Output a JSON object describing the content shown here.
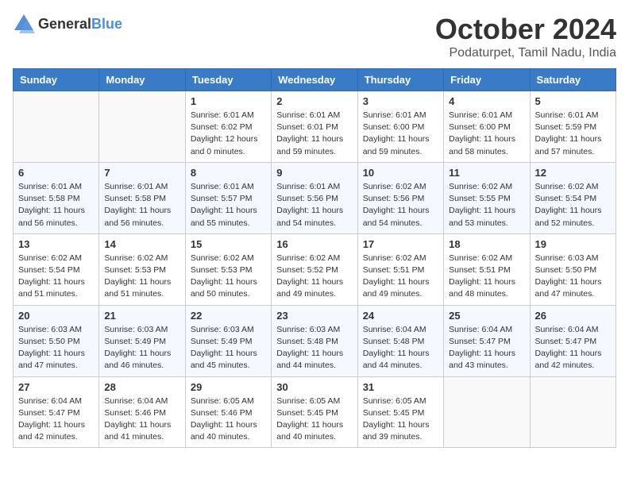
{
  "header": {
    "logo_general": "General",
    "logo_blue": "Blue",
    "month": "October 2024",
    "location": "Podaturpet, Tamil Nadu, India"
  },
  "weekdays": [
    "Sunday",
    "Monday",
    "Tuesday",
    "Wednesday",
    "Thursday",
    "Friday",
    "Saturday"
  ],
  "weeks": [
    [
      {
        "day": "",
        "info": ""
      },
      {
        "day": "",
        "info": ""
      },
      {
        "day": "1",
        "info": "Sunrise: 6:01 AM\nSunset: 6:02 PM\nDaylight: 12 hours\nand 0 minutes."
      },
      {
        "day": "2",
        "info": "Sunrise: 6:01 AM\nSunset: 6:01 PM\nDaylight: 11 hours\nand 59 minutes."
      },
      {
        "day": "3",
        "info": "Sunrise: 6:01 AM\nSunset: 6:00 PM\nDaylight: 11 hours\nand 59 minutes."
      },
      {
        "day": "4",
        "info": "Sunrise: 6:01 AM\nSunset: 6:00 PM\nDaylight: 11 hours\nand 58 minutes."
      },
      {
        "day": "5",
        "info": "Sunrise: 6:01 AM\nSunset: 5:59 PM\nDaylight: 11 hours\nand 57 minutes."
      }
    ],
    [
      {
        "day": "6",
        "info": "Sunrise: 6:01 AM\nSunset: 5:58 PM\nDaylight: 11 hours\nand 56 minutes."
      },
      {
        "day": "7",
        "info": "Sunrise: 6:01 AM\nSunset: 5:58 PM\nDaylight: 11 hours\nand 56 minutes."
      },
      {
        "day": "8",
        "info": "Sunrise: 6:01 AM\nSunset: 5:57 PM\nDaylight: 11 hours\nand 55 minutes."
      },
      {
        "day": "9",
        "info": "Sunrise: 6:01 AM\nSunset: 5:56 PM\nDaylight: 11 hours\nand 54 minutes."
      },
      {
        "day": "10",
        "info": "Sunrise: 6:02 AM\nSunset: 5:56 PM\nDaylight: 11 hours\nand 54 minutes."
      },
      {
        "day": "11",
        "info": "Sunrise: 6:02 AM\nSunset: 5:55 PM\nDaylight: 11 hours\nand 53 minutes."
      },
      {
        "day": "12",
        "info": "Sunrise: 6:02 AM\nSunset: 5:54 PM\nDaylight: 11 hours\nand 52 minutes."
      }
    ],
    [
      {
        "day": "13",
        "info": "Sunrise: 6:02 AM\nSunset: 5:54 PM\nDaylight: 11 hours\nand 51 minutes."
      },
      {
        "day": "14",
        "info": "Sunrise: 6:02 AM\nSunset: 5:53 PM\nDaylight: 11 hours\nand 51 minutes."
      },
      {
        "day": "15",
        "info": "Sunrise: 6:02 AM\nSunset: 5:53 PM\nDaylight: 11 hours\nand 50 minutes."
      },
      {
        "day": "16",
        "info": "Sunrise: 6:02 AM\nSunset: 5:52 PM\nDaylight: 11 hours\nand 49 minutes."
      },
      {
        "day": "17",
        "info": "Sunrise: 6:02 AM\nSunset: 5:51 PM\nDaylight: 11 hours\nand 49 minutes."
      },
      {
        "day": "18",
        "info": "Sunrise: 6:02 AM\nSunset: 5:51 PM\nDaylight: 11 hours\nand 48 minutes."
      },
      {
        "day": "19",
        "info": "Sunrise: 6:03 AM\nSunset: 5:50 PM\nDaylight: 11 hours\nand 47 minutes."
      }
    ],
    [
      {
        "day": "20",
        "info": "Sunrise: 6:03 AM\nSunset: 5:50 PM\nDaylight: 11 hours\nand 47 minutes."
      },
      {
        "day": "21",
        "info": "Sunrise: 6:03 AM\nSunset: 5:49 PM\nDaylight: 11 hours\nand 46 minutes."
      },
      {
        "day": "22",
        "info": "Sunrise: 6:03 AM\nSunset: 5:49 PM\nDaylight: 11 hours\nand 45 minutes."
      },
      {
        "day": "23",
        "info": "Sunrise: 6:03 AM\nSunset: 5:48 PM\nDaylight: 11 hours\nand 44 minutes."
      },
      {
        "day": "24",
        "info": "Sunrise: 6:04 AM\nSunset: 5:48 PM\nDaylight: 11 hours\nand 44 minutes."
      },
      {
        "day": "25",
        "info": "Sunrise: 6:04 AM\nSunset: 5:47 PM\nDaylight: 11 hours\nand 43 minutes."
      },
      {
        "day": "26",
        "info": "Sunrise: 6:04 AM\nSunset: 5:47 PM\nDaylight: 11 hours\nand 42 minutes."
      }
    ],
    [
      {
        "day": "27",
        "info": "Sunrise: 6:04 AM\nSunset: 5:47 PM\nDaylight: 11 hours\nand 42 minutes."
      },
      {
        "day": "28",
        "info": "Sunrise: 6:04 AM\nSunset: 5:46 PM\nDaylight: 11 hours\nand 41 minutes."
      },
      {
        "day": "29",
        "info": "Sunrise: 6:05 AM\nSunset: 5:46 PM\nDaylight: 11 hours\nand 40 minutes."
      },
      {
        "day": "30",
        "info": "Sunrise: 6:05 AM\nSunset: 5:45 PM\nDaylight: 11 hours\nand 40 minutes."
      },
      {
        "day": "31",
        "info": "Sunrise: 6:05 AM\nSunset: 5:45 PM\nDaylight: 11 hours\nand 39 minutes."
      },
      {
        "day": "",
        "info": ""
      },
      {
        "day": "",
        "info": ""
      }
    ]
  ]
}
